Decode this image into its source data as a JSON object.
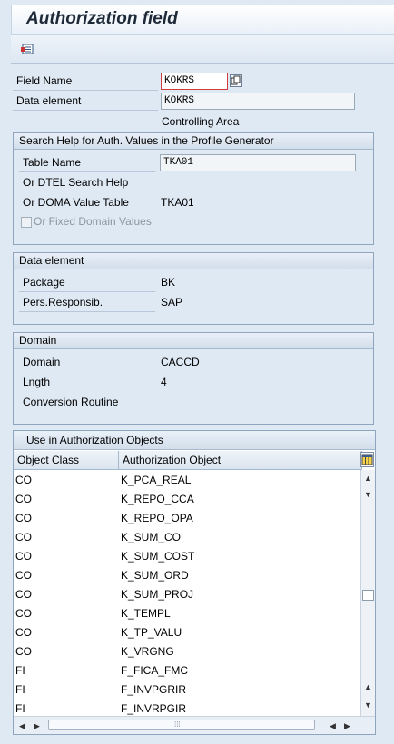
{
  "window": {
    "title": "Authorization field"
  },
  "toolbar": {
    "icon": "display-object-list-icon"
  },
  "header": {
    "field_name_label": "Field Name",
    "field_name_value": "KOKRS",
    "data_element_label": "Data element",
    "data_element_value": "KOKRS",
    "description": "Controlling Area"
  },
  "search_help": {
    "title": "Search Help for Auth. Values in the Profile Generator",
    "table_name_label": "Table Name",
    "table_name_value": "TKA01",
    "dtel_label": "Or DTEL Search Help",
    "doma_label": "Or DOMA Value Table",
    "doma_value": "TKA01",
    "fixed_label": "Or Fixed Domain Values"
  },
  "data_element_group": {
    "title": "Data element",
    "package_label": "Package",
    "package_value": "BK",
    "pers_label": "Pers.Responsib.",
    "pers_value": "SAP"
  },
  "domain_group": {
    "title": "Domain",
    "domain_label": "Domain",
    "domain_value": "CACCD",
    "length_label": "Lngth",
    "length_value": "4",
    "conversion_label": "Conversion Routine"
  },
  "table": {
    "title": "Use in Authorization Objects",
    "col_class": "Object Class",
    "col_object": "Authorization Object",
    "rows": [
      [
        "CO",
        "K_PCA_REAL"
      ],
      [
        "CO",
        "K_REPO_CCA"
      ],
      [
        "CO",
        "K_REPO_OPA"
      ],
      [
        "CO",
        "K_SUM_CO"
      ],
      [
        "CO",
        "K_SUM_COST"
      ],
      [
        "CO",
        "K_SUM_ORD"
      ],
      [
        "CO",
        "K_SUM_PROJ"
      ],
      [
        "CO",
        "K_TEMPL"
      ],
      [
        "CO",
        "K_TP_VALU"
      ],
      [
        "CO",
        "K_VRGNG"
      ],
      [
        "FI",
        "F_FICA_FMC"
      ],
      [
        "FI",
        "F_INVPGRIR"
      ],
      [
        "FI",
        "F_INVRPGIR"
      ]
    ]
  }
}
